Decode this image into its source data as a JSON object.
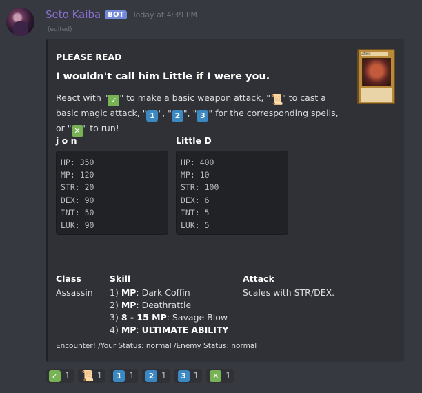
{
  "message": {
    "username": "Seto Kaiba",
    "bot_tag": "BOT",
    "timestamp": "Today at 4:39 PM",
    "edited": "(edited)"
  },
  "embed": {
    "author": "PLEASE READ",
    "title": "I wouldn't call him Little if I were you.",
    "description": {
      "t1": "React with \"",
      "t2": "\" to make a basic weapon attack, \"",
      "t3": "\" to cast a basic magic attack, \"",
      "t4": "\", \"",
      "t5": "\", \"",
      "t6": "\" for the corresponding spells, or \"",
      "t7": "\" to run!"
    },
    "thumbnail": {
      "card_name": "Little D"
    },
    "player": {
      "name": "j o n",
      "stats": [
        "HP: 350",
        "MP: 120",
        "STR: 20",
        "DEX: 90",
        "INT: 50",
        "LUK: 90"
      ]
    },
    "enemy": {
      "name": "Little D",
      "stats": [
        "HP: 400",
        "MP: 10",
        "STR: 100",
        "DEX: 6",
        "INT: 5",
        "LUK: 5"
      ]
    },
    "class": {
      "name": "Class",
      "value": "Assassin"
    },
    "skill": {
      "name": "Skill",
      "lines": [
        {
          "prefix": "1) ",
          "bold": "MP",
          "rest": ": Dark Coffin"
        },
        {
          "prefix": "2) ",
          "bold": "MP",
          "rest": ": Deathrattle"
        },
        {
          "prefix": "3) ",
          "bold": "8 - 15 MP",
          "rest": ": Savage Blow"
        },
        {
          "prefix": "4) ",
          "bold": "MP",
          "rest": ": ",
          "bold2": "ULTIMATE ABILITY"
        }
      ]
    },
    "attack": {
      "name": "Attack",
      "value": "Scales with STR/DEX."
    },
    "footer": "Encounter! /Your Status: normal /Enemy Status: normal"
  },
  "emoji": {
    "check": "✓",
    "scroll": "📜",
    "one": "1",
    "two": "2",
    "three": "3",
    "cross": "✕"
  },
  "reactions": [
    {
      "icon": "check-icon",
      "glyph": "✓",
      "count": "1"
    },
    {
      "icon": "scroll-icon",
      "glyph": "📜",
      "count": "1"
    },
    {
      "icon": "one-icon",
      "glyph": "1",
      "count": "1"
    },
    {
      "icon": "two-icon",
      "glyph": "2",
      "count": "1"
    },
    {
      "icon": "three-icon",
      "glyph": "3",
      "count": "1"
    },
    {
      "icon": "cross-icon",
      "glyph": "✕",
      "count": "1"
    }
  ],
  "colors": {
    "background": "#36393f",
    "embed": "#2f3136",
    "username": "#8a6fd1",
    "bot_tag": "#7289da",
    "keycap": "#3b88c3",
    "green": "#77b255"
  }
}
